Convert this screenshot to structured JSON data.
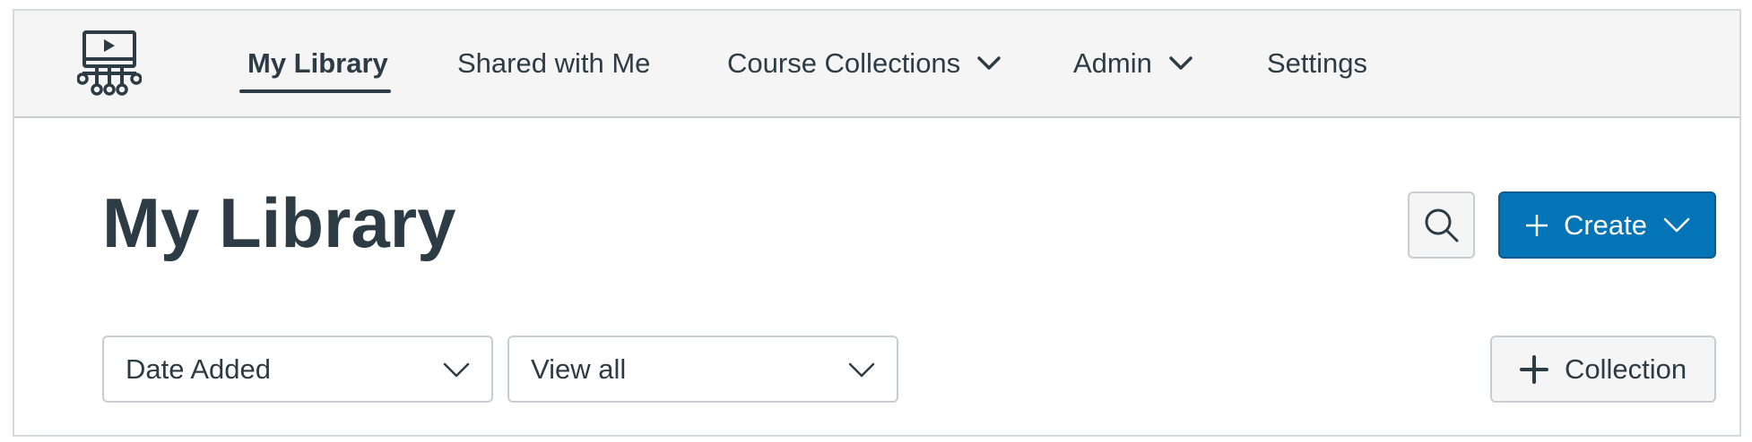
{
  "app": {
    "logo_icon": "video-library-icon"
  },
  "nav": {
    "items": [
      {
        "label": "My Library",
        "active": true
      },
      {
        "label": "Shared with Me",
        "active": false
      },
      {
        "label": "Course Collections",
        "active": false,
        "has_dropdown": true
      },
      {
        "label": "Admin",
        "active": false,
        "has_dropdown": true
      },
      {
        "label": "Settings",
        "active": false
      }
    ]
  },
  "page": {
    "title": "My Library"
  },
  "toolbar": {
    "search_icon": "search-icon",
    "create_label": "Create"
  },
  "filters": {
    "sort_selected": "Date Added",
    "view_selected": "View all"
  },
  "collection": {
    "add_label": "Collection"
  },
  "colors": {
    "primary": "#0374b5",
    "text": "#2d3b45",
    "nav_bg": "#f5f5f5",
    "border": "#c7cdd1"
  }
}
